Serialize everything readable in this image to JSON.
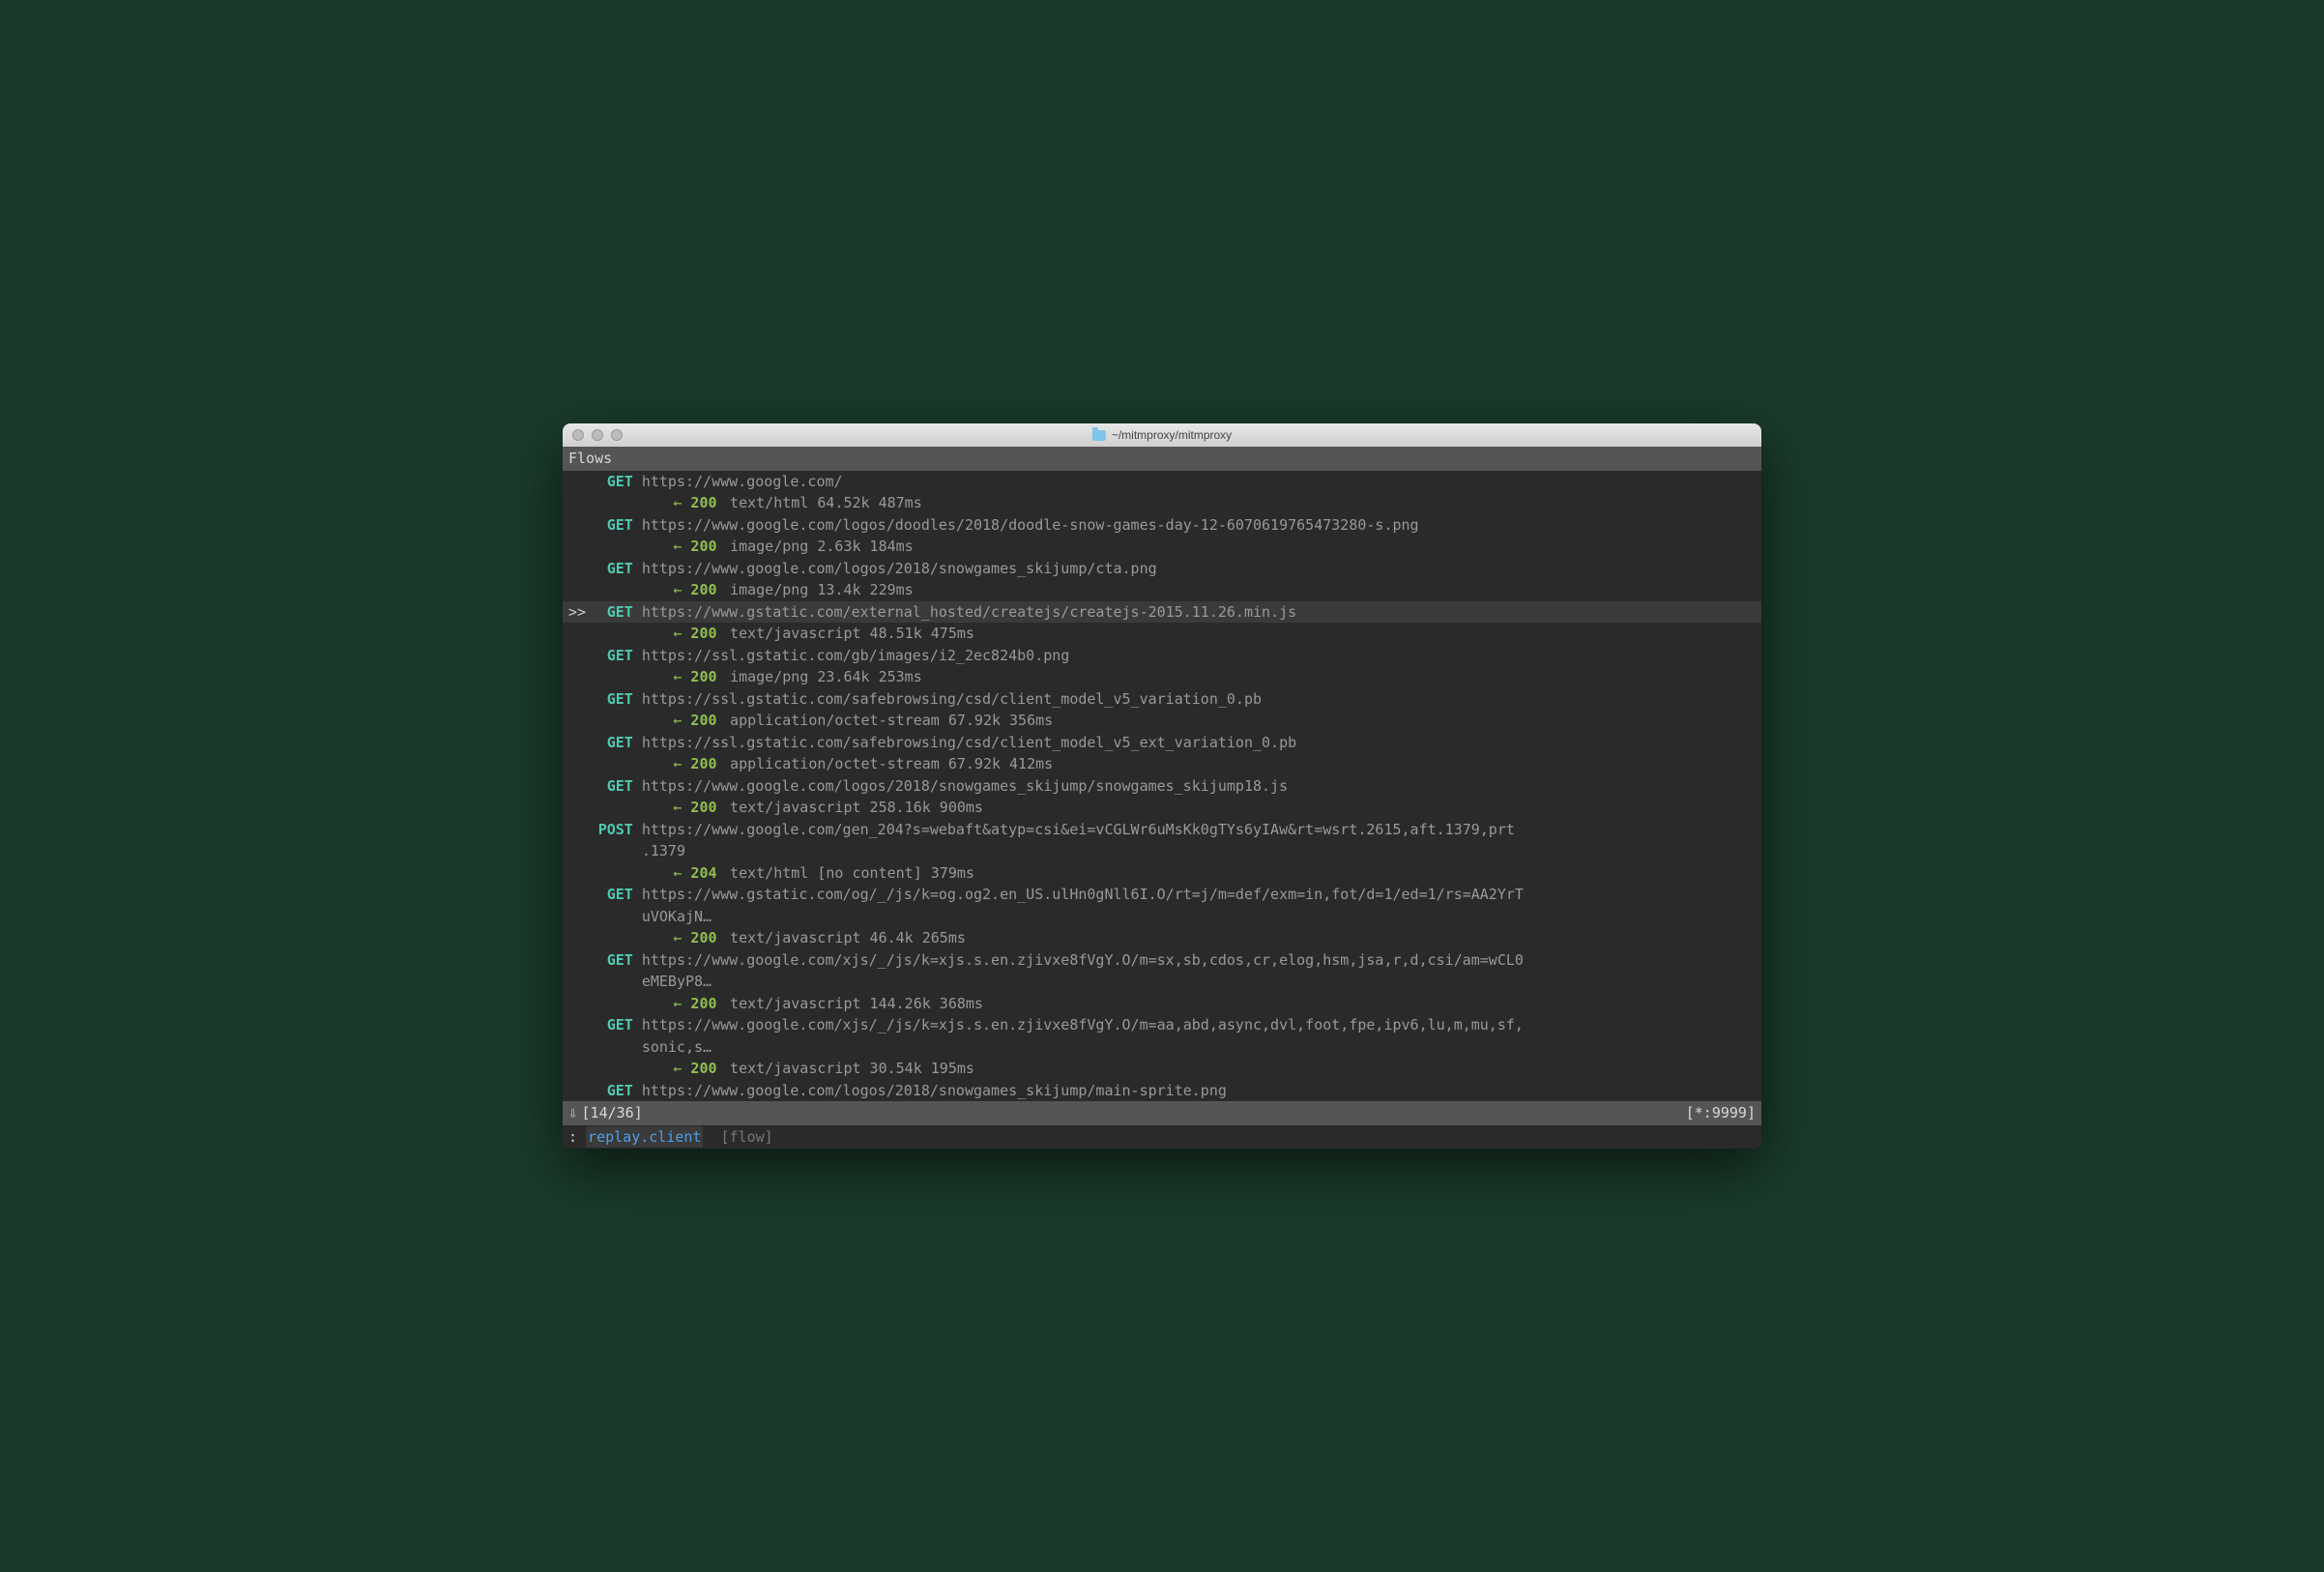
{
  "window": {
    "title": "~/mitmproxy/mitmproxy"
  },
  "header": "Flows",
  "flows": [
    {
      "cursor": "",
      "method": "GET",
      "url": "https://www.google.com/",
      "status": "200",
      "meta": "text/html 64.52k 487ms"
    },
    {
      "cursor": "",
      "method": "GET",
      "url": "https://www.google.com/logos/doodles/2018/doodle-snow-games-day-12-6070619765473280-s.png",
      "status": "200",
      "meta": "image/png 2.63k 184ms"
    },
    {
      "cursor": "",
      "method": "GET",
      "url": "https://www.google.com/logos/2018/snowgames_skijump/cta.png",
      "status": "200",
      "meta": "image/png 13.4k 229ms"
    },
    {
      "cursor": ">>",
      "method": "GET",
      "url": "https://www.gstatic.com/external_hosted/createjs/createjs-2015.11.26.min.js",
      "status": "200",
      "meta": "text/javascript 48.51k 475ms"
    },
    {
      "cursor": "",
      "method": "GET",
      "url": "https://ssl.gstatic.com/gb/images/i2_2ec824b0.png",
      "status": "200",
      "meta": "image/png 23.64k 253ms"
    },
    {
      "cursor": "",
      "method": "GET",
      "url": "https://ssl.gstatic.com/safebrowsing/csd/client_model_v5_variation_0.pb",
      "status": "200",
      "meta": "application/octet-stream 67.92k 356ms"
    },
    {
      "cursor": "",
      "method": "GET",
      "url": "https://ssl.gstatic.com/safebrowsing/csd/client_model_v5_ext_variation_0.pb",
      "status": "200",
      "meta": "application/octet-stream 67.92k 412ms"
    },
    {
      "cursor": "",
      "method": "GET",
      "url": "https://www.google.com/logos/2018/snowgames_skijump/snowgames_skijump18.js",
      "status": "200",
      "meta": "text/javascript 258.16k 900ms"
    },
    {
      "cursor": "",
      "method": "POST",
      "url": "https://www.google.com/gen_204?s=webaft&atyp=csi&ei=vCGLWr6uMsKk0gTYs6yIAw&rt=wsrt.2615,aft.1379,prt",
      "url2": ".1379",
      "status": "204",
      "meta": "text/html [no content] 379ms"
    },
    {
      "cursor": "",
      "method": "GET",
      "url": "https://www.gstatic.com/og/_/js/k=og.og2.en_US.ulHn0gNll6I.O/rt=j/m=def/exm=in,fot/d=1/ed=1/rs=AA2YrT",
      "url2": "uVOKajN…",
      "status": "200",
      "meta": "text/javascript 46.4k 265ms"
    },
    {
      "cursor": "",
      "method": "GET",
      "url": "https://www.google.com/xjs/_/js/k=xjs.s.en.zjivxe8fVgY.O/m=sx,sb,cdos,cr,elog,hsm,jsa,r,d,csi/am=wCL0",
      "url2": "eMEByP8…",
      "status": "200",
      "meta": "text/javascript 144.26k 368ms"
    },
    {
      "cursor": "",
      "method": "GET",
      "url": "https://www.google.com/xjs/_/js/k=xjs.s.en.zjivxe8fVgY.O/m=aa,abd,async,dvl,foot,fpe,ipv6,lu,m,mu,sf,",
      "url2": "sonic,s…",
      "status": "200",
      "meta": "text/javascript 30.54k 195ms"
    },
    {
      "cursor": "",
      "method": "GET",
      "url": "https://www.google.com/logos/2018/snowgames_skijump/main-sprite.png",
      "status": "",
      "meta": ""
    }
  ],
  "statusbar": {
    "down_arrow": "⇩",
    "position": "[14/36]",
    "listen": "[*:9999]"
  },
  "cmdline": {
    "prompt": ":",
    "text": "replay.client",
    "hint": "[flow]"
  }
}
